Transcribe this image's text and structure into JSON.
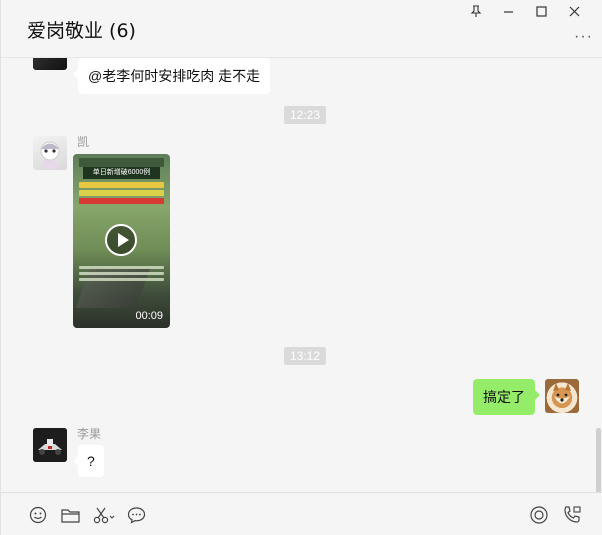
{
  "header": {
    "title": "爱岗敬业 (6)",
    "window_controls": [
      "pin-icon",
      "minimize-icon",
      "maximize-icon",
      "close-icon"
    ],
    "more_label": "···"
  },
  "messages": {
    "msg1_text": "@老李何时安排吃肉 走不走",
    "time1": "12:23",
    "sender2_name": "凯",
    "video": {
      "header_text": "单日新增破6000例",
      "duration": "00:09"
    },
    "time2": "13:12",
    "mine_text": "搞定了",
    "sender3_name": "李果",
    "msg3_text": "?"
  },
  "toolbar": {
    "icons": [
      "emoji-icon",
      "folder-icon",
      "scissors-icon",
      "chat-history-icon",
      "voice-call-icon",
      "video-call-icon"
    ]
  },
  "colors": {
    "background": "#f5f5f5",
    "bubble_mine": "#95ec69",
    "bubble_other": "#ffffff",
    "time_pill": "#dadada"
  }
}
